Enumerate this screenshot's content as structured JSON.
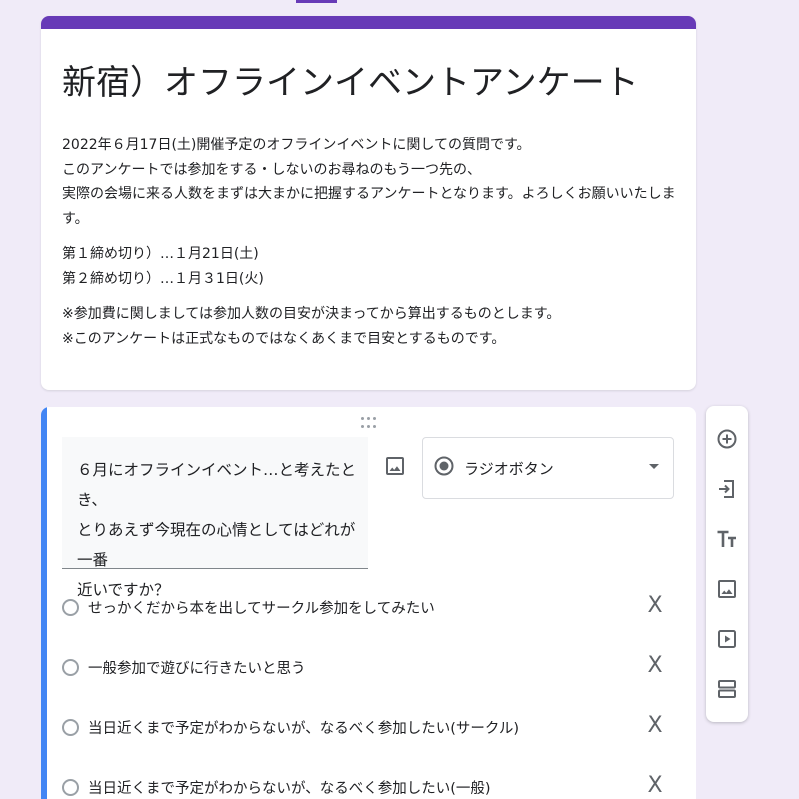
{
  "form": {
    "title": "新宿）オフラインイベントアンケート",
    "description": [
      "2022年６月17日(土)開催予定のオフラインイベントに関しての質問です。\nこのアンケートでは参加をする・しないのお尋ねのもう一つ先の、\n実際の会場に来る人数をまずは大まかに把握するアンケートとなります。よろしくお願いいたします。",
      "第１締め切り）…１月21日(土)\n第２締め切り）…１月３1日(火)",
      "※参加費に関しましては参加人数の目安が決まってから算出するものとします。\n※このアンケートは正式なものではなくあくまで目安とするものです。"
    ]
  },
  "question": {
    "text": "６月にオフラインイベント…と考えたとき、\nとりあえず今現在の心情としてはどれが一番\n近いですか？",
    "type_label": "ラジオボタン",
    "options": [
      "せっかくだから本を出してサークル参加をしてみたい",
      "一般参加で遊びに行きたいと思う",
      "当日近くまで予定がわからないが、なるべく参加したい(サークル)",
      "当日近くまで予定がわからないが、なるべく参加したい(一般)"
    ],
    "remove_symbol": "X"
  },
  "toolbar": {
    "items": [
      "add-question-icon",
      "import-questions-icon",
      "add-title-icon",
      "add-image-icon",
      "add-video-icon",
      "add-section-icon"
    ]
  },
  "colors": {
    "theme": "#673ab7",
    "background": "#f0ebf8",
    "active_accent": "#4285f4"
  }
}
